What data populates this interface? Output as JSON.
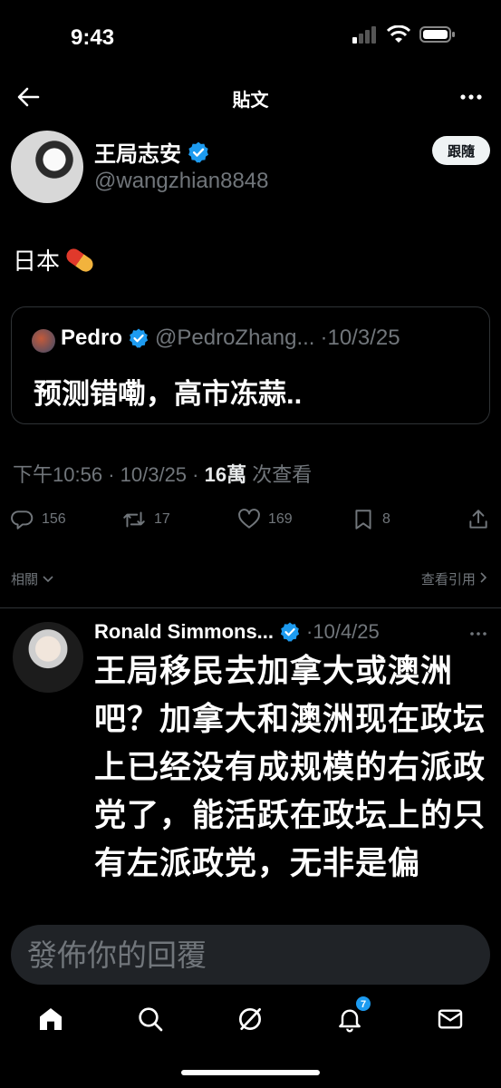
{
  "status": {
    "time": "9:43"
  },
  "header": {
    "title": "貼文"
  },
  "post": {
    "author_name": "王局志安",
    "author_handle": "@wangzhian8848",
    "follow_label": "跟隨",
    "text": "日本",
    "quote": {
      "name": "Pedro",
      "handle": "@PedroZhang...",
      "date": "·10/3/25",
      "text": "预测错嘞，高市冻蒜.."
    },
    "meta": {
      "time": "下午10:56",
      "date": "10/3/25",
      "views_count": "16萬",
      "views_label": "次查看",
      "sep": "·"
    },
    "actions": {
      "replies": "156",
      "reposts": "17",
      "likes": "169",
      "bookmarks": "8"
    }
  },
  "related": {
    "left": "相關",
    "right": "查看引用"
  },
  "reply": {
    "name": "Ronald Simmons...",
    "date": "·10/4/25",
    "text": "王局移民去加拿大或澳洲吧？加拿大和澳洲现在政坛上已经没有成规模的右派政党了，能活跃在政坛上的只有左派政党，无非是偏"
  },
  "compose": {
    "placeholder": "發佈你的回覆"
  },
  "tabbar": {
    "notifications_badge": "7"
  },
  "colors": {
    "accent": "#1d9bf0",
    "secondary_text": "#71767b",
    "background": "#000000"
  },
  "icons": [
    "back-arrow-icon",
    "more-icon",
    "verified-icon",
    "reply-icon",
    "repost-icon",
    "like-icon",
    "bookmark-icon",
    "share-icon",
    "home-icon",
    "search-icon",
    "grok-icon",
    "bell-icon",
    "mail-icon"
  ]
}
